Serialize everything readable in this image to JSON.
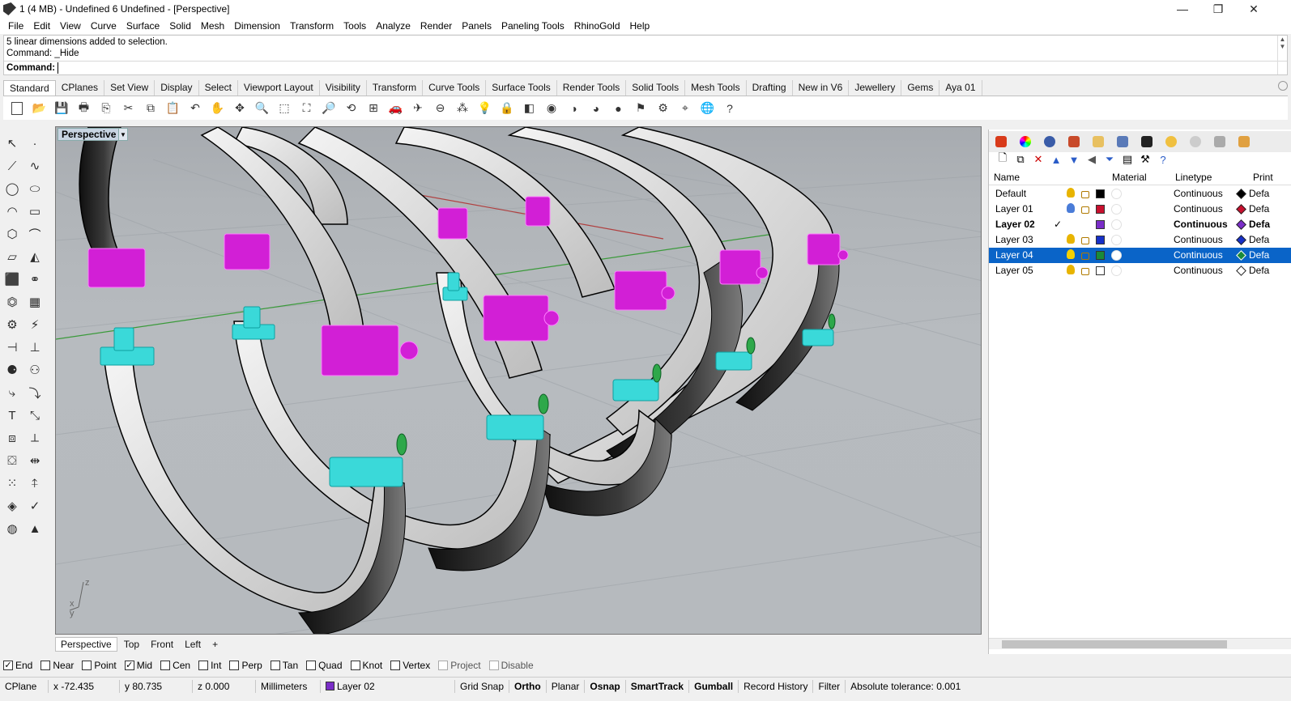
{
  "window": {
    "title": "1 (4 MB) - Undefined 6 Undefined - [Perspective]",
    "minimize": "—",
    "restore": "❐",
    "close": "✕"
  },
  "menu": [
    "File",
    "Edit",
    "View",
    "Curve",
    "Surface",
    "Solid",
    "Mesh",
    "Dimension",
    "Transform",
    "Tools",
    "Analyze",
    "Render",
    "Panels",
    "Paneling Tools",
    "RhinoGold",
    "Help"
  ],
  "command": {
    "history_1": "5 linear dimensions added to selection.",
    "history_2": "Command: _Hide",
    "prompt": "Command:",
    "value": ""
  },
  "toolbar_tabs": [
    "Standard",
    "CPlanes",
    "Set View",
    "Display",
    "Select",
    "Viewport Layout",
    "Visibility",
    "Transform",
    "Curve Tools",
    "Surface Tools",
    "Render Tools",
    "Solid Tools",
    "Mesh Tools",
    "Drafting",
    "New in V6",
    "Jewellery",
    "Gems",
    "Aya 01"
  ],
  "viewport": {
    "label": "Perspective",
    "axis_x": "x",
    "axis_y": "y",
    "axis_z": "z",
    "colors": {
      "band_light": "#e8e8e8",
      "band_dark": "#2e2e2e",
      "clasp_magenta": "#d21fd6",
      "clasp_cyan": "#3ad9d9",
      "grid": "#9ea3a8",
      "axis_x": "#b04040",
      "axis_y": "#3a9a3a"
    }
  },
  "view_tabs": [
    "Perspective",
    "Top",
    "Front",
    "Left",
    "+"
  ],
  "layers": {
    "headers": {
      "name": "Name",
      "material": "Material",
      "linetype": "Linetype",
      "print": "Print"
    },
    "rows": [
      {
        "name": "Default",
        "current": "",
        "color": "#000000",
        "linetype": "Continuous",
        "print": "Defa",
        "bulb": "#e8b400",
        "selected": false
      },
      {
        "name": "Layer 01",
        "current": "",
        "color": "#c8102e",
        "linetype": "Continuous",
        "print": "Defa",
        "bulb": "#4a7cd8",
        "selected": false
      },
      {
        "name": "Layer 02",
        "current": "✓",
        "color": "#7a2dc8",
        "linetype": "Continuous",
        "print": "Defa",
        "bulb": "",
        "selected": false
      },
      {
        "name": "Layer 03",
        "current": "",
        "color": "#1630c8",
        "linetype": "Continuous",
        "print": "Defa",
        "bulb": "#e8b400",
        "selected": false
      },
      {
        "name": "Layer 04",
        "current": "",
        "color": "#1a8a3a",
        "linetype": "Continuous",
        "print": "Defa",
        "bulb": "#f4d000",
        "selected": true
      },
      {
        "name": "Layer 05",
        "current": "",
        "color": "#ffffff",
        "linetype": "Continuous",
        "print": "Defa",
        "bulb": "#e8b400",
        "selected": false
      }
    ]
  },
  "osnaps": [
    {
      "label": "End",
      "checked": true,
      "disabled": false
    },
    {
      "label": "Near",
      "checked": false,
      "disabled": false
    },
    {
      "label": "Point",
      "checked": false,
      "disabled": false
    },
    {
      "label": "Mid",
      "checked": true,
      "disabled": false
    },
    {
      "label": "Cen",
      "checked": false,
      "disabled": false
    },
    {
      "label": "Int",
      "checked": false,
      "disabled": false
    },
    {
      "label": "Perp",
      "checked": false,
      "disabled": false
    },
    {
      "label": "Tan",
      "checked": false,
      "disabled": false
    },
    {
      "label": "Quad",
      "checked": false,
      "disabled": false
    },
    {
      "label": "Knot",
      "checked": false,
      "disabled": false
    },
    {
      "label": "Vertex",
      "checked": false,
      "disabled": false
    },
    {
      "label": "Project",
      "checked": false,
      "disabled": true
    },
    {
      "label": "Disable",
      "checked": false,
      "disabled": true
    }
  ],
  "status": {
    "cplane": "CPlane",
    "x": "x -72.435",
    "y": "y 80.735",
    "z": "z 0.000",
    "units": "Millimeters",
    "layer": "Layer 02",
    "grid_snap": "Grid Snap",
    "ortho": "Ortho",
    "planar": "Planar",
    "osnap": "Osnap",
    "smarttrack": "SmartTrack",
    "gumball": "Gumball",
    "record_history": "Record History",
    "filter": "Filter",
    "tolerance": "Absolute tolerance: 0.001"
  }
}
